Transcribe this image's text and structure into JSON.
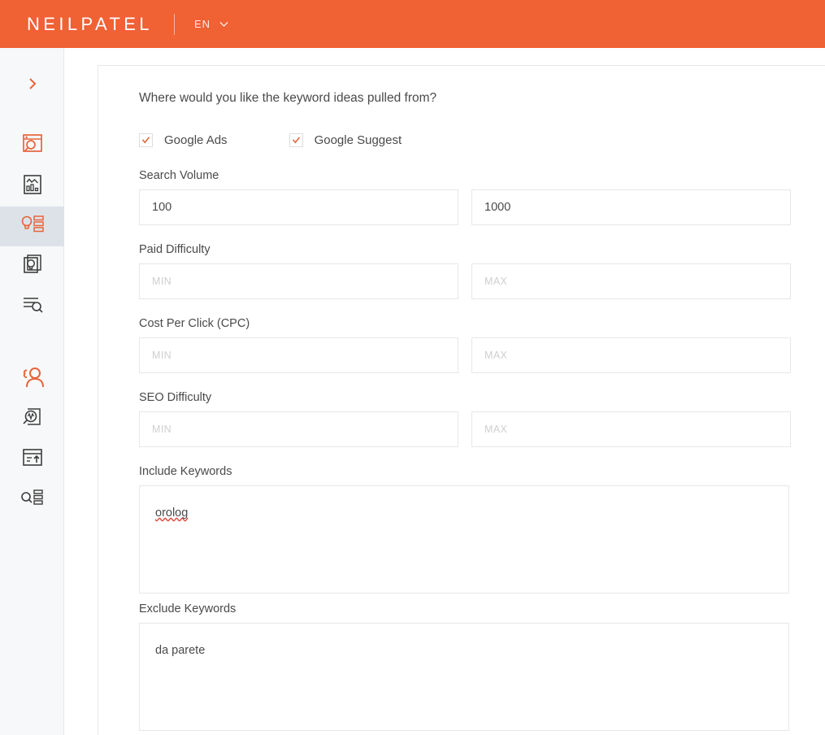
{
  "header": {
    "brand": "NEILPATEL",
    "language": "EN",
    "chevron_icon": "chevron-down-icon",
    "background_color": "#F06134"
  },
  "sidebar": {
    "background_color": "#F7F8F9",
    "active_background_color": "#DDE2E8",
    "accent_color": "#E8643C",
    "items": [
      {
        "icon": "chevron-right-expand-icon",
        "name": "expand-sidebar",
        "active": false
      },
      {
        "icon": "site-audit-magnifier-icon",
        "name": "site-audit",
        "active": false
      },
      {
        "icon": "traffic-analyzer-chart-icon",
        "name": "traffic-analyzer",
        "active": false
      },
      {
        "icon": "keyword-ideas-bulb-list-icon",
        "name": "keyword-ideas",
        "active": true
      },
      {
        "icon": "content-ideas-bulb-icon",
        "name": "content-ideas",
        "active": false
      },
      {
        "icon": "keyword-search-lines-icon",
        "name": "keyword-overview",
        "active": false
      },
      {
        "icon": "competitors-people-icon",
        "name": "competitors",
        "active": false
      },
      {
        "icon": "page-analytics-magnifier-icon",
        "name": "page-analytics",
        "active": false
      },
      {
        "icon": "upload-report-icon",
        "name": "upload-report",
        "active": false
      },
      {
        "icon": "search-list-icon",
        "name": "search-list",
        "active": false
      }
    ]
  },
  "form": {
    "question": "Where would you like the keyword ideas pulled from?",
    "sources": [
      {
        "label": "Google Ads",
        "checked": true
      },
      {
        "label": "Google Suggest",
        "checked": true
      }
    ],
    "ranges": [
      {
        "label": "Search Volume",
        "min_value": "100",
        "max_value": "1000",
        "min_placeholder": "MIN",
        "max_placeholder": "MAX"
      },
      {
        "label": "Paid Difficulty",
        "min_value": "",
        "max_value": "",
        "min_placeholder": "MIN",
        "max_placeholder": "MAX"
      },
      {
        "label": "Cost Per Click (CPC)",
        "min_value": "",
        "max_value": "",
        "min_placeholder": "MIN",
        "max_placeholder": "MAX"
      },
      {
        "label": "SEO Difficulty",
        "min_value": "",
        "max_value": "",
        "min_placeholder": "MIN",
        "max_placeholder": "MAX"
      }
    ],
    "include_keywords": {
      "label": "Include Keywords",
      "value": "orolog",
      "placeholder": ""
    },
    "exclude_keywords": {
      "label": "Exclude Keywords",
      "value": "da parete",
      "placeholder": ""
    }
  }
}
